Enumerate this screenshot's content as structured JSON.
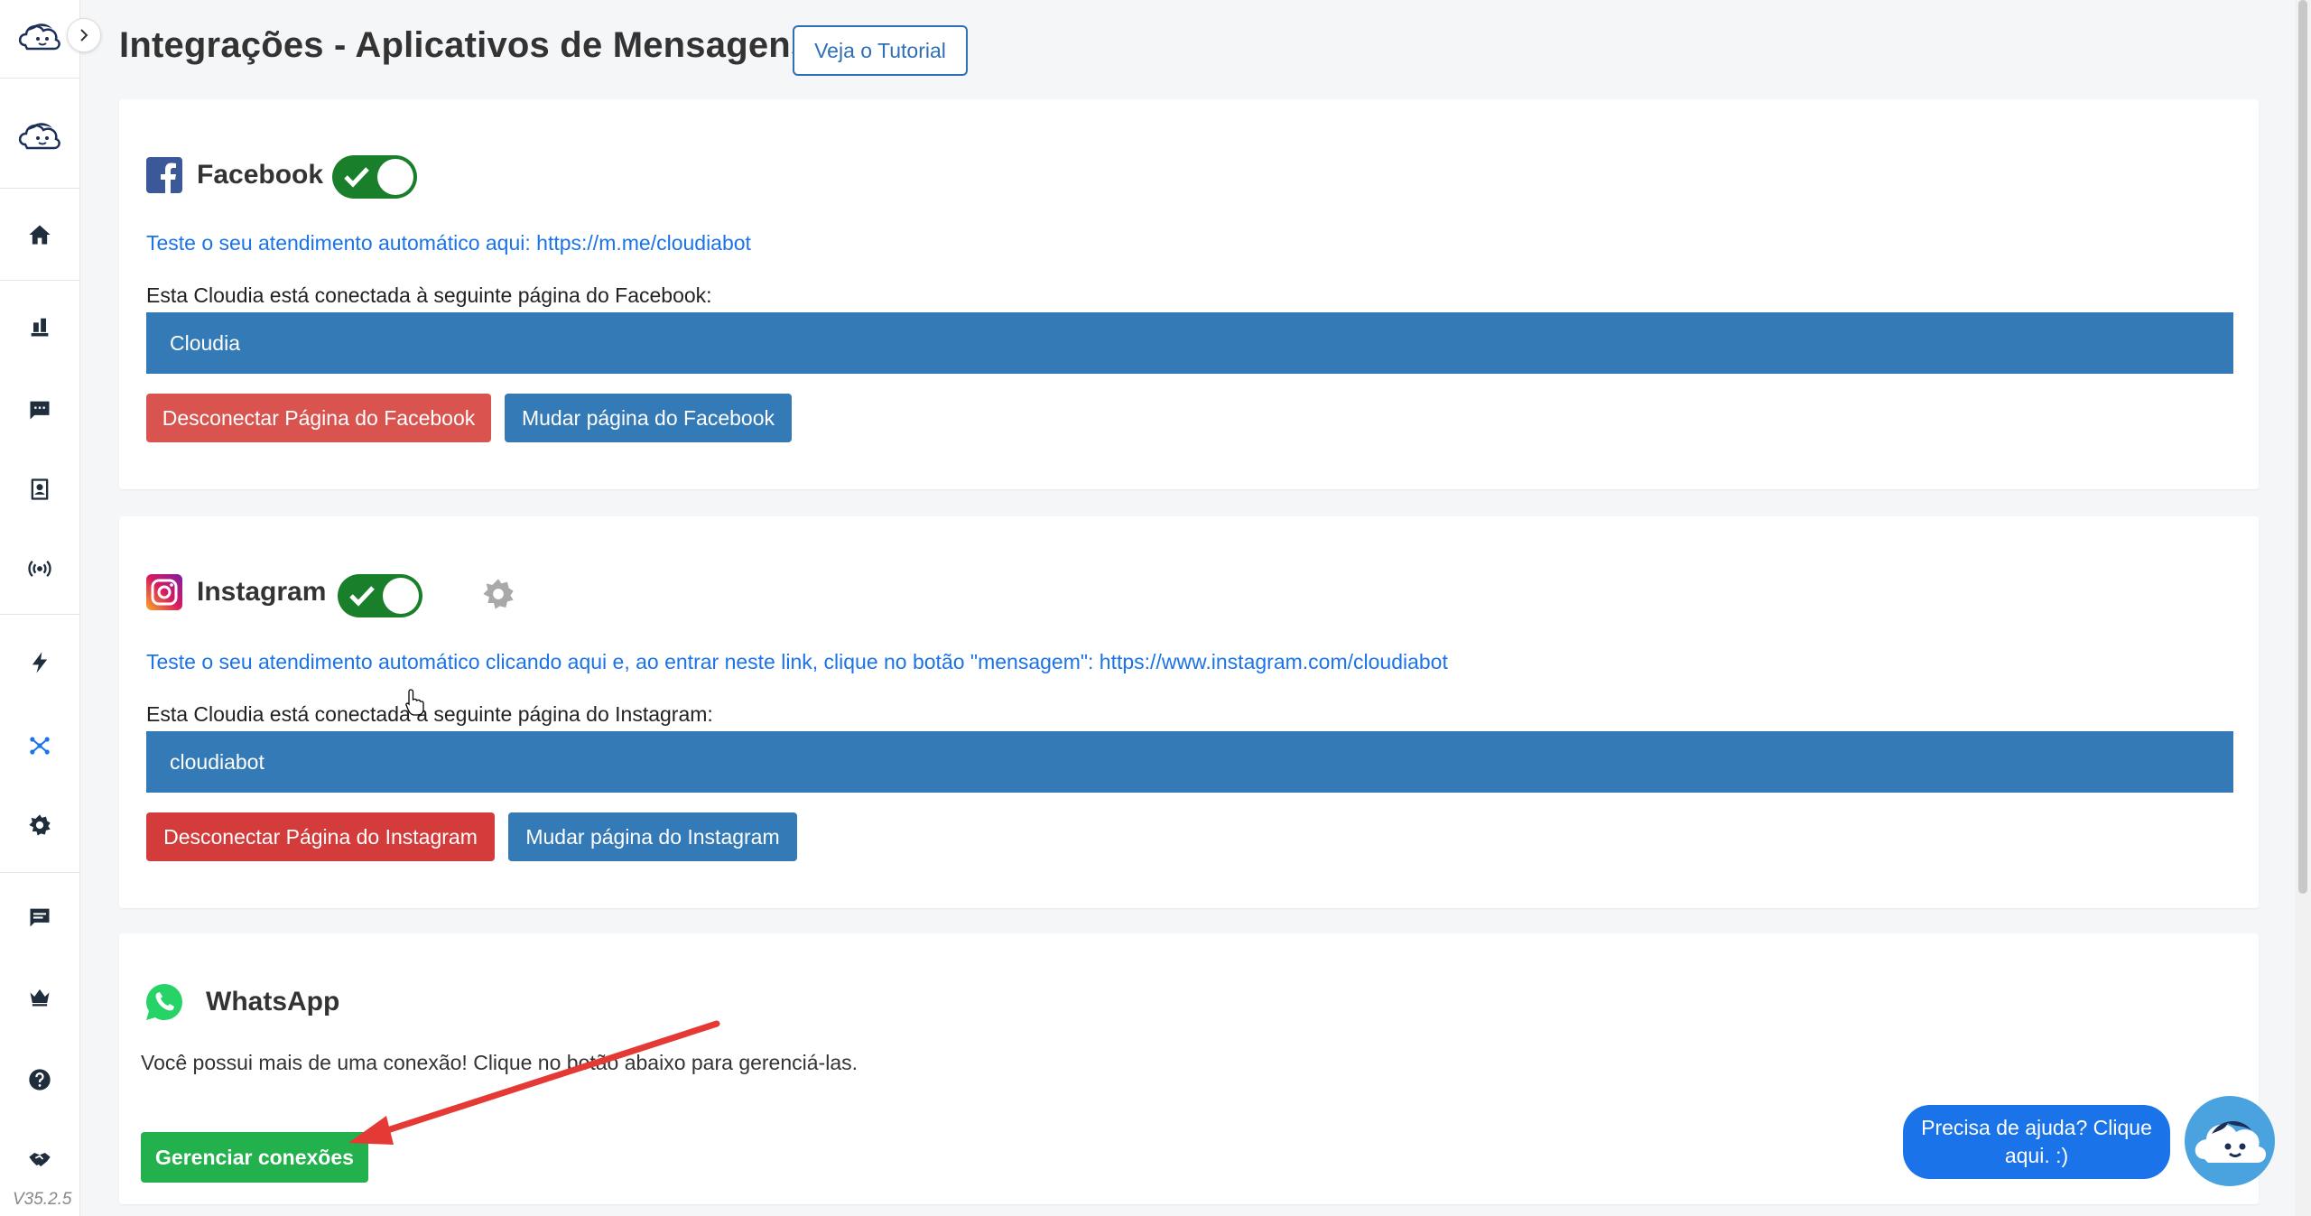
{
  "app": {
    "version": "V35.2.5"
  },
  "sidebar": {
    "items": [
      {
        "name": "home-icon"
      },
      {
        "name": "dashboard-icon"
      },
      {
        "name": "chat-icon"
      },
      {
        "name": "contacts-icon"
      },
      {
        "name": "broadcast-icon"
      },
      {
        "name": "bolt-icon"
      },
      {
        "name": "integrations-icon",
        "active": true
      },
      {
        "name": "settings-icon"
      },
      {
        "name": "messages-icon"
      },
      {
        "name": "crown-icon"
      },
      {
        "name": "help-icon"
      },
      {
        "name": "handshake-icon"
      }
    ]
  },
  "header": {
    "title": "Integrações - Aplicativos de Mensagens",
    "tutorial_label": "Veja o Tutorial"
  },
  "facebook": {
    "name": "Facebook",
    "enabled": true,
    "test_link": "Teste o seu atendimento automático aqui: https://m.me/cloudiabot",
    "connected_label": "Esta Cloudia está conectada à seguinte página do Facebook:",
    "page_name": "Cloudia",
    "disconnect_label": "Desconectar Página do Facebook",
    "change_label": "Mudar página do Facebook"
  },
  "instagram": {
    "name": "Instagram",
    "enabled": true,
    "test_link": "Teste o seu atendimento automático clicando aqui e, ao entrar neste link, clique no botão \"mensagem\": https://www.instagram.com/cloudiabot",
    "connected_label": "Esta Cloudia está conectada à seguinte página do Instagram:",
    "page_name": "cloudiabot",
    "disconnect_label": "Desconectar Página do Instagram",
    "change_label": "Mudar página do Instagram"
  },
  "whatsapp": {
    "name": "WhatsApp",
    "message": "Você possui mais de uma conexão! Clique no botão abaixo para gerenciá-las.",
    "manage_label": "Gerenciar conexões"
  },
  "help": {
    "line1": "Precisa de ajuda? Clique",
    "line2": "aqui. :)"
  },
  "colors": {
    "primary": "#337ab7",
    "danger": "#d9534f",
    "success": "#22b14c",
    "toggle_on": "#1a7f2a",
    "link": "#1a73e8",
    "annotation_arrow": "#e53935"
  }
}
